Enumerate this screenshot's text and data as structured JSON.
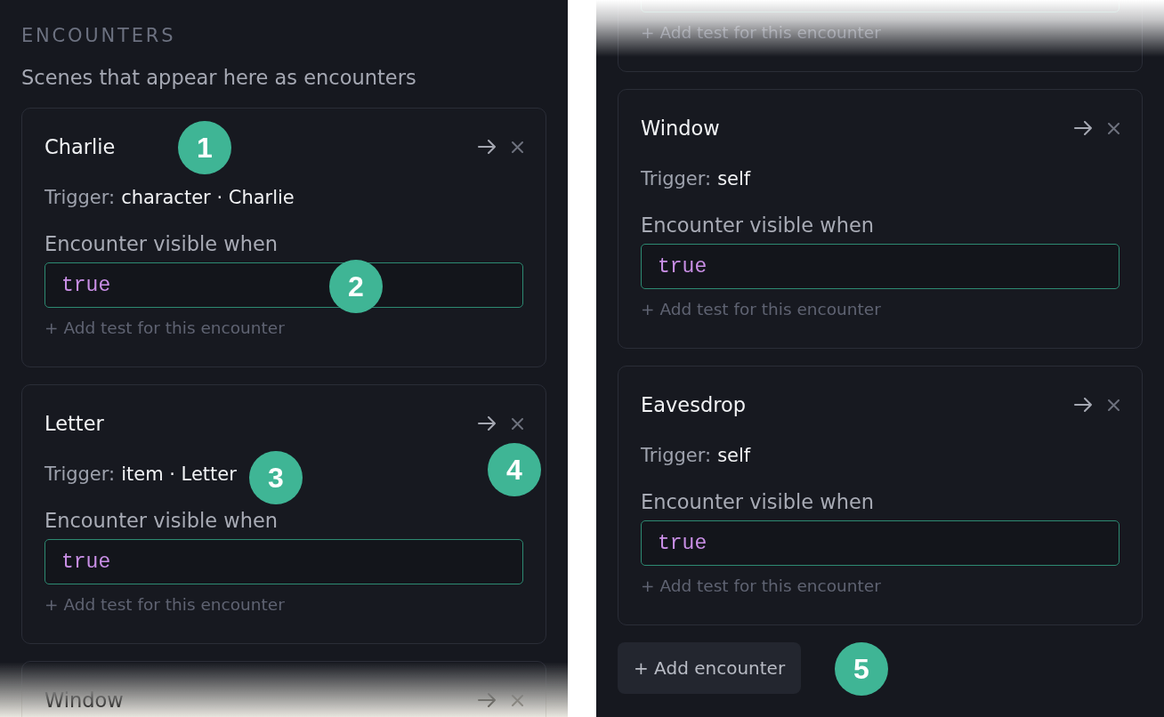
{
  "panels": [
    {
      "heading": "ENCOUNTERS",
      "description": "Scenes that appear here as encounters",
      "fade_top": false,
      "fade_bottom": true,
      "encounters": [
        {
          "kind": "full",
          "title": "Charlie",
          "trigger_label": "Trigger:",
          "trigger_value": "character · Charlie",
          "condition_label": "Encounter visible when",
          "condition": "true",
          "add_test": "+ Add test for this encounter"
        },
        {
          "kind": "full",
          "title": "Letter",
          "trigger_label": "Trigger:",
          "trigger_value": "item · Letter",
          "condition_label": "Encounter visible when",
          "condition": "true",
          "add_test": "+ Add test for this encounter"
        },
        {
          "kind": "cut_bottom",
          "title": "Window"
        }
      ]
    },
    {
      "fade_top": true,
      "fade_bottom": false,
      "encounters": [
        {
          "kind": "cut_top",
          "add_test": "+ Add test for this encounter"
        },
        {
          "kind": "full",
          "title": "Window",
          "trigger_label": "Trigger:",
          "trigger_value": "self",
          "condition_label": "Encounter visible when",
          "condition": "true",
          "add_test": "+ Add test for this encounter"
        },
        {
          "kind": "full",
          "title": "Eavesdrop",
          "trigger_label": "Trigger:",
          "trigger_value": "self",
          "condition_label": "Encounter visible when",
          "condition": "true",
          "add_test": "+ Add test for this encounter"
        }
      ],
      "add_button": "+ Add encounter"
    }
  ],
  "step_markers": [
    "1",
    "2",
    "3",
    "4",
    "5"
  ]
}
